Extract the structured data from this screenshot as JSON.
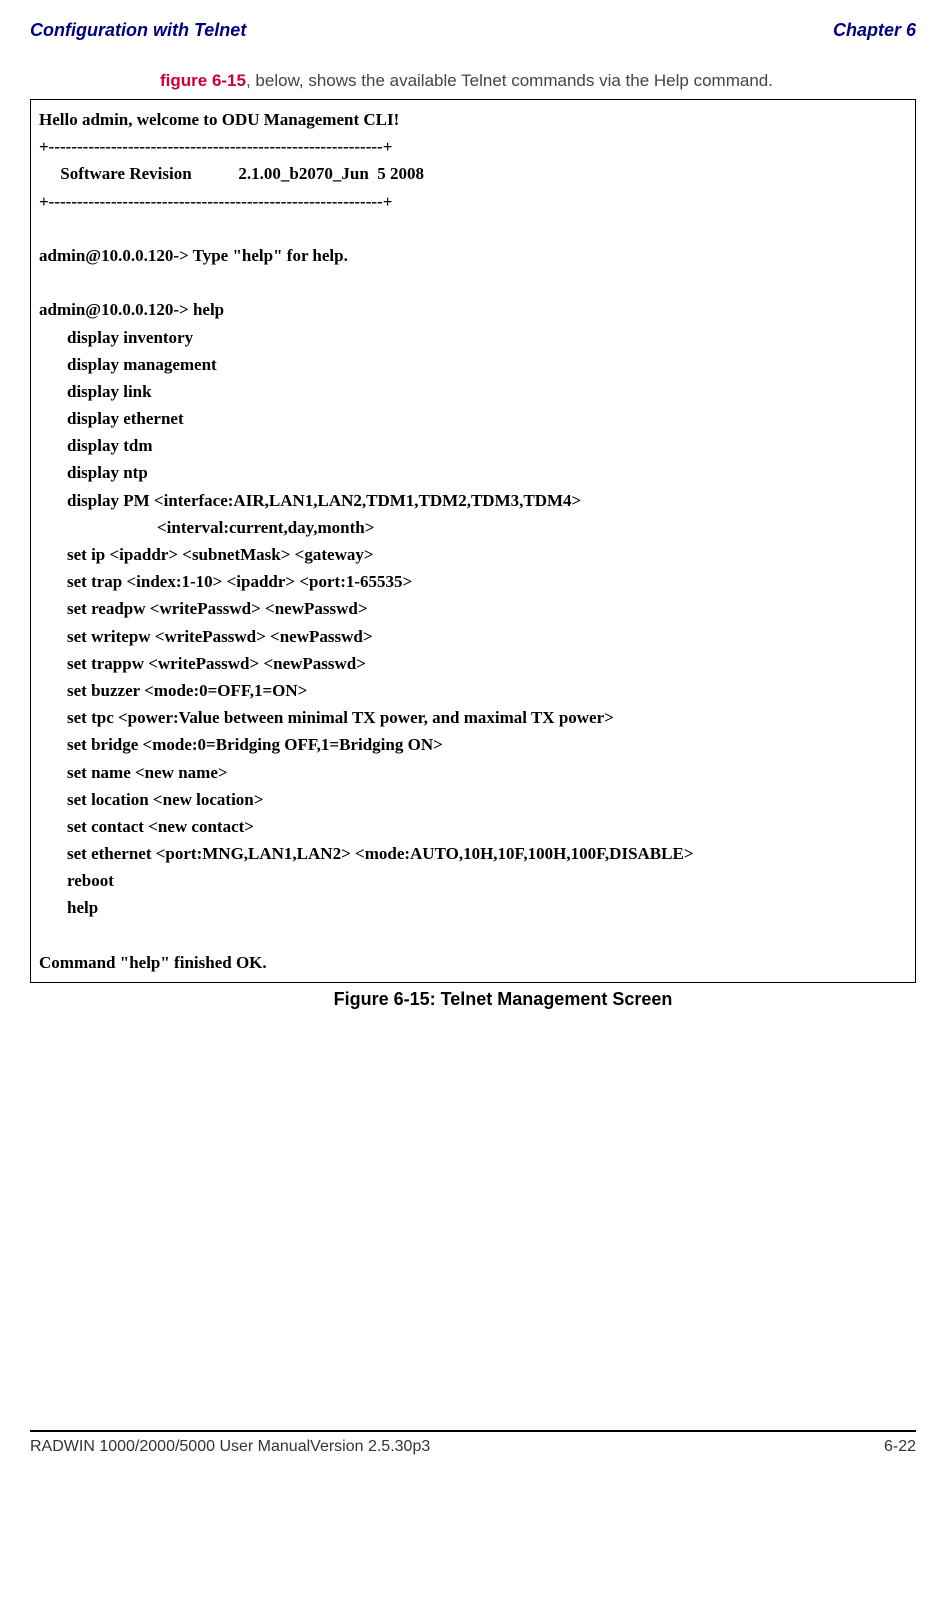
{
  "header": {
    "left": "Configuration with Telnet",
    "right": "Chapter 6"
  },
  "intro": {
    "figref": "figure 6-15",
    "rest": ", below, shows the available Telnet commands via the Help command."
  },
  "cli": {
    "welcome": "Hello admin, welcome to ODU Management CLI!",
    "rule": "+-----------------------------------------------------------+",
    "swrev": "     Software Revision           2.1.00_b2070_Jun  5 2008",
    "typehelp": "admin@10.0.0.120-> Type \"help\" for help.",
    "helpline": "admin@10.0.0.120-> help",
    "cmds": [
      "display inventory",
      "display management",
      "display link",
      "display ethernet",
      "display tdm",
      "display ntp",
      "display PM <interface:AIR,LAN1,LAN2,TDM1,TDM2,TDM3,TDM4>"
    ],
    "interval": "<interval:current,day,month>",
    "cmds2": [
      "set ip <ipaddr> <subnetMask> <gateway>",
      "set trap <index:1-10> <ipaddr> <port:1-65535>",
      "set readpw <writePasswd> <newPasswd>",
      "set writepw <writePasswd> <newPasswd>",
      "set trappw <writePasswd> <newPasswd>",
      "set buzzer <mode:0=OFF,1=ON>",
      "set tpc <power:Value between minimal TX power, and maximal TX power>",
      "set bridge <mode:0=Bridging OFF,1=Bridging ON>",
      "set name <new name>",
      "set location <new location>",
      "set contact <new contact>",
      "set ethernet <port:MNG,LAN1,LAN2> <mode:AUTO,10H,10F,100H,100F,DISABLE>",
      "reboot",
      "help"
    ],
    "finished": "Command \"help\" finished OK."
  },
  "caption": "Figure 6-15: Telnet Management Screen",
  "footer": {
    "left": "RADWIN 1000/2000/5000 User ManualVersion  2.5.30p3",
    "right": "6-22"
  }
}
